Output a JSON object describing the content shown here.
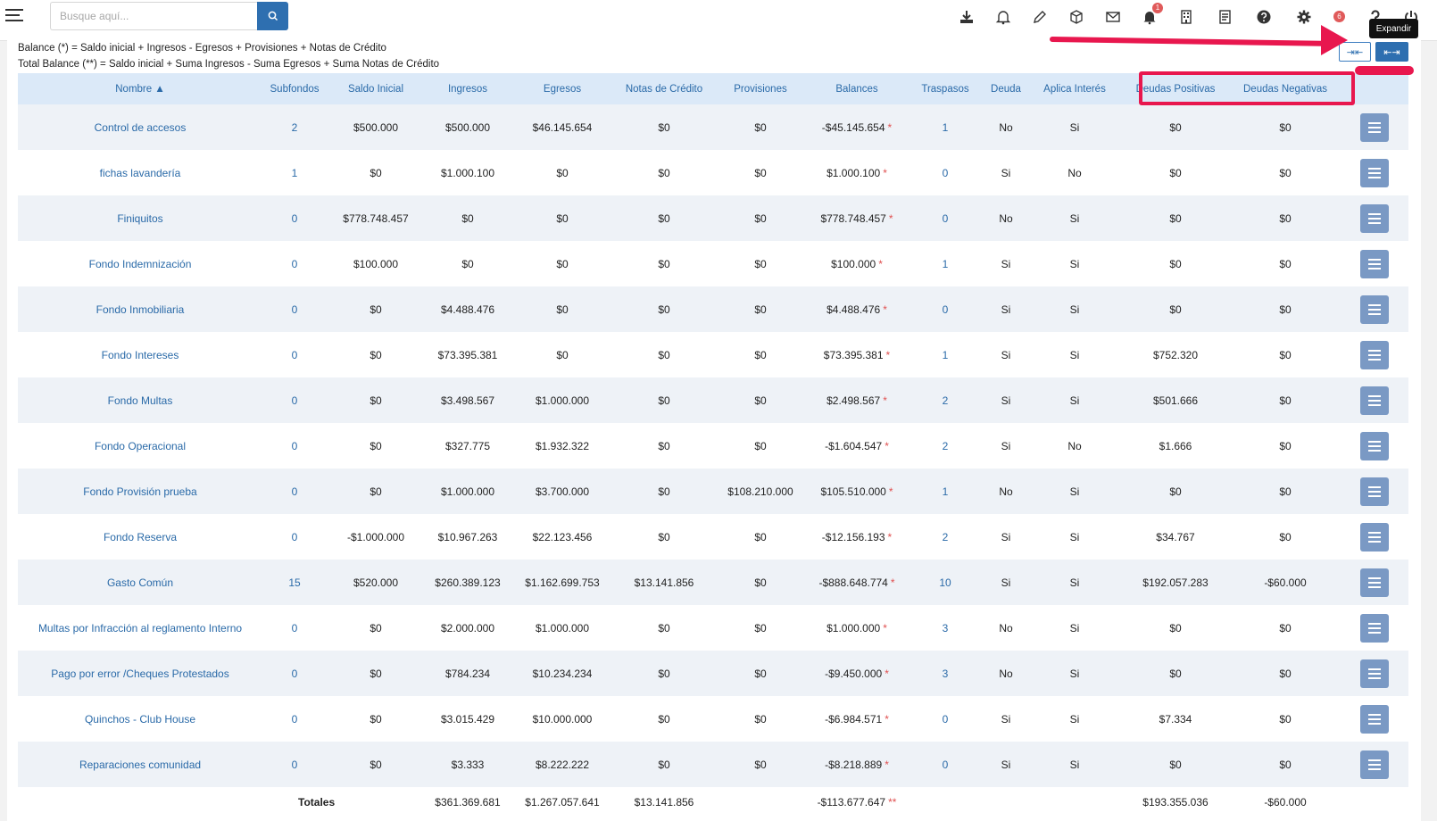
{
  "search": {
    "placeholder": "Busque aquí..."
  },
  "notifications": {
    "alerts_count": "1",
    "user_count": "6"
  },
  "formulas": {
    "balance": "Balance (*) = Saldo inicial + Ingresos - Egresos + Provisiones + Notas de Crédito",
    "total_balance": "Total Balance (**) = Saldo inicial + Suma Ingresos - Suma Egresos + Suma Notas de Crédito"
  },
  "controls": {
    "collapse_label": "⇥⇤",
    "expand_label": "⇤⇥",
    "tooltip": "Expandir"
  },
  "colors": {
    "primary": "#2e6fb0",
    "annotation": "#e8174e",
    "link": "#2a6aa8"
  },
  "table": {
    "headers": [
      "Nombre ▲",
      "Subfondos",
      "Saldo Inicial",
      "Ingresos",
      "Egresos",
      "Notas de Crédito",
      "Provisiones",
      "Balances",
      "Traspasos",
      "Deuda",
      "Aplica Interés",
      "Deudas Positivas",
      "Deudas Negativas",
      ""
    ],
    "rows": [
      [
        "Control de accesos",
        "2",
        "$500.000",
        "$500.000",
        "$46.145.654",
        "$0",
        "$0",
        "-$45.145.654",
        "1",
        "No",
        "Si",
        "$0",
        "$0"
      ],
      [
        "fichas lavandería",
        "1",
        "$0",
        "$1.000.100",
        "$0",
        "$0",
        "$0",
        "$1.000.100",
        "0",
        "Si",
        "No",
        "$0",
        "$0"
      ],
      [
        "Finiquitos",
        "0",
        "$778.748.457",
        "$0",
        "$0",
        "$0",
        "$0",
        "$778.748.457",
        "0",
        "No",
        "Si",
        "$0",
        "$0"
      ],
      [
        "Fondo Indemnización",
        "0",
        "$100.000",
        "$0",
        "$0",
        "$0",
        "$0",
        "$100.000",
        "1",
        "Si",
        "Si",
        "$0",
        "$0"
      ],
      [
        "Fondo Inmobiliaria",
        "0",
        "$0",
        "$4.488.476",
        "$0",
        "$0",
        "$0",
        "$4.488.476",
        "0",
        "Si",
        "Si",
        "$0",
        "$0"
      ],
      [
        "Fondo Intereses",
        "0",
        "$0",
        "$73.395.381",
        "$0",
        "$0",
        "$0",
        "$73.395.381",
        "1",
        "Si",
        "Si",
        "$752.320",
        "$0"
      ],
      [
        "Fondo Multas",
        "0",
        "$0",
        "$3.498.567",
        "$1.000.000",
        "$0",
        "$0",
        "$2.498.567",
        "2",
        "Si",
        "Si",
        "$501.666",
        "$0"
      ],
      [
        "Fondo Operacional",
        "0",
        "$0",
        "$327.775",
        "$1.932.322",
        "$0",
        "$0",
        "-$1.604.547",
        "2",
        "Si",
        "No",
        "$1.666",
        "$0"
      ],
      [
        "Fondo Provisión prueba",
        "0",
        "$0",
        "$1.000.000",
        "$3.700.000",
        "$0",
        "$108.210.000",
        "$105.510.000",
        "1",
        "No",
        "Si",
        "$0",
        "$0"
      ],
      [
        "Fondo Reserva",
        "0",
        "-$1.000.000",
        "$10.967.263",
        "$22.123.456",
        "$0",
        "$0",
        "-$12.156.193",
        "2",
        "Si",
        "Si",
        "$34.767",
        "$0"
      ],
      [
        "Gasto Común",
        "15",
        "$520.000",
        "$260.389.123",
        "$1.162.699.753",
        "$13.141.856",
        "$0",
        "-$888.648.774",
        "10",
        "Si",
        "Si",
        "$192.057.283",
        "-$60.000"
      ],
      [
        "Multas por Infracción al reglamento Interno",
        "0",
        "$0",
        "$2.000.000",
        "$1.000.000",
        "$0",
        "$0",
        "$1.000.000",
        "3",
        "No",
        "Si",
        "$0",
        "$0"
      ],
      [
        "Pago por error /Cheques Protestados",
        "0",
        "$0",
        "$784.234",
        "$10.234.234",
        "$0",
        "$0",
        "-$9.450.000",
        "3",
        "No",
        "Si",
        "$0",
        "$0"
      ],
      [
        "Quinchos - Club House",
        "0",
        "$0",
        "$3.015.429",
        "$10.000.000",
        "$0",
        "$0",
        "-$6.984.571",
        "0",
        "Si",
        "Si",
        "$7.334",
        "$0"
      ],
      [
        "Reparaciones comunidad",
        "0",
        "$0",
        "$3.333",
        "$8.222.222",
        "$0",
        "$0",
        "-$8.218.889",
        "0",
        "Si",
        "Si",
        "$0",
        "$0"
      ]
    ],
    "balance_marker": "*",
    "totals": {
      "label": "Totales",
      "ingresos": "$361.369.681",
      "egresos": "$1.267.057.641",
      "notas": "$13.141.856",
      "balances": "-$113.677.647",
      "balances_marker": "**",
      "deudas_positivas": "$193.355.036",
      "deudas_negativas": "-$60.000"
    }
  }
}
